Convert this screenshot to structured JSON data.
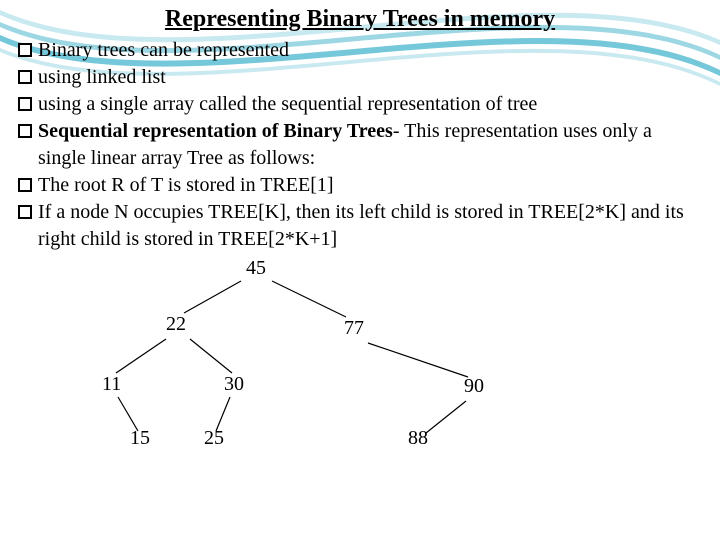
{
  "title": "Representing Binary Trees in memory",
  "lines": {
    "l1": "Binary trees can be represented",
    "l2": "using linked list",
    "l3": "using a single array called the sequential representation of tree",
    "l4_pre": "Sequential representation of Binary Trees",
    "l4_post": "- This representation uses only a single linear array Tree as follows:",
    "l5": "The root R of T is stored in TREE[1]",
    "l6": "If a node N occupies TREE[K], then its left child is stored in TREE[2*K] and its right child is stored in TREE[2*K+1]"
  },
  "tree": {
    "n45": "45",
    "n22": "22",
    "n77": "77",
    "n11": "11",
    "n30": "30",
    "n90": "90",
    "n15": "15",
    "n25": "25",
    "n88": "88"
  },
  "colors": {
    "wave1": "#9ed7e4",
    "wave2": "#75c7da",
    "wave3": "#c9e9f0"
  }
}
